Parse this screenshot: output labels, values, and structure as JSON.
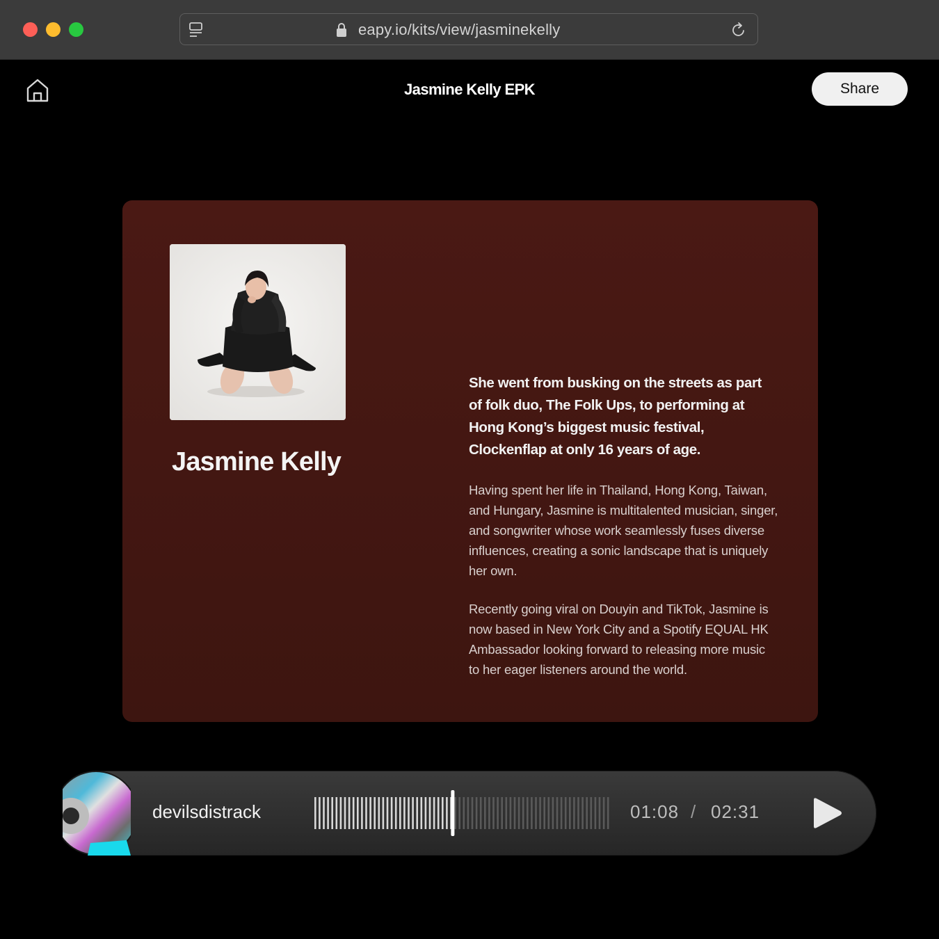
{
  "browser": {
    "url": "eapy.io/kits/view/jasminekelly"
  },
  "header": {
    "title": "Jasmine Kelly EPK",
    "share_label": "Share"
  },
  "profile": {
    "name": "Jasmine Kelly",
    "bio_lead": "She went from busking on the streets as part of folk duo, The Folk Ups, to performing at Hong Kong’s biggest music festival, Clockenflap at only 16 years of age.",
    "bio_paragraphs": [
      "Having spent her life in Thailand, Hong Kong, Taiwan, and Hungary, Jasmine is multitalented musician, singer, and songwriter whose work seamlessly fuses diverse influences, creating a sonic landscape that is uniquely her own.",
      "Recently going viral on Douyin and TikTok, Jasmine is now based in New York City and a Spotify EQUAL HK Ambassador looking forward to releasing more music to her eager listeners around the world."
    ]
  },
  "player": {
    "track": "devilsdistrack",
    "current_time": "01:08",
    "separator": "/",
    "total_time": "02:31",
    "progress": 0.466
  },
  "colors": {
    "card_bg": "#4a1914",
    "played_bar": "#d8d8d8",
    "unplayed_bar": "#5a5a5a"
  }
}
